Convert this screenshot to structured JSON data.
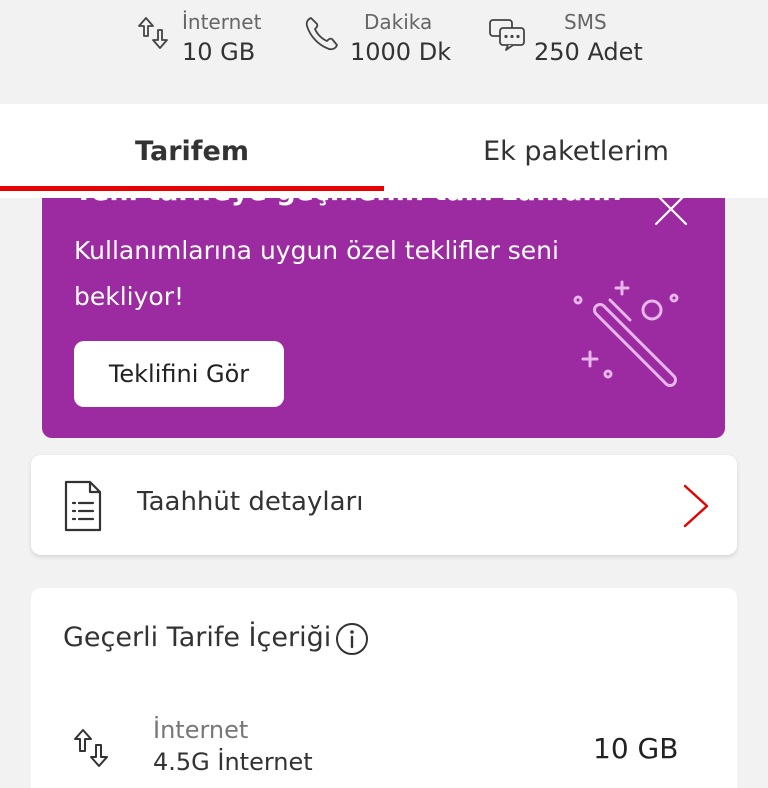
{
  "summary": {
    "internet": {
      "label": "İnternet",
      "value": "10 GB",
      "icon": "internet-transfer-icon"
    },
    "minutes": {
      "label": "Dakika",
      "value": "1000 Dk",
      "icon": "phone-icon"
    },
    "sms": {
      "label": "SMS",
      "value": "250 Adet",
      "icon": "chat-bubbles-icon"
    }
  },
  "tabs": [
    {
      "label": "Tarifem",
      "active": true
    },
    {
      "label": "Ek paketlerim",
      "active": false
    }
  ],
  "promo": {
    "title": "Yeni tarifeye geçmenin tam zamanı!",
    "text": "Kullanımlarına uygun özel teklifler seni bekliyor!",
    "button_label": "Teklifini Gör",
    "background": "#9c2aa0",
    "icon": "magic-wand-icon"
  },
  "commitment": {
    "label": "Taahhüt detayları",
    "icon": "document-icon"
  },
  "tariff": {
    "title": "Geçerli Tarife İçeriği",
    "rows": [
      {
        "name": "İnternet",
        "sub": "4.5G İnternet",
        "value": "10 GB",
        "icon": "internet-transfer-icon"
      }
    ]
  },
  "colors": {
    "accent": "#e60000",
    "promo": "#9c2aa0",
    "background": "#f2f2f2"
  }
}
